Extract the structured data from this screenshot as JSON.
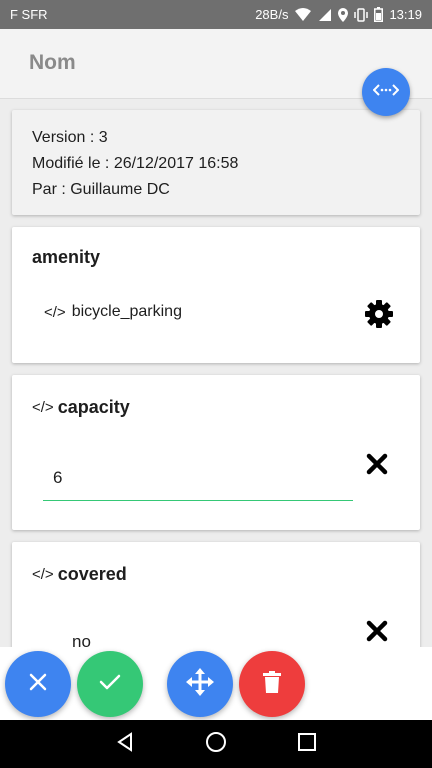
{
  "status_bar": {
    "carrier": "F SFR",
    "speed": "28B/s",
    "time": "13:19"
  },
  "header": {
    "title": "Nom"
  },
  "info": {
    "version": "Version : 3",
    "modified": "Modifié le : 26/12/2017 16:58",
    "author": "Par : Guillaume DC"
  },
  "tags": [
    {
      "key": "amenity",
      "value": "bicycle_parking"
    },
    {
      "key": "capacity",
      "value": "6"
    },
    {
      "key": "covered",
      "value": "no"
    }
  ],
  "glyphs": {
    "code": "</>"
  },
  "colors": {
    "blue": "#3e84f0",
    "green": "#35c876",
    "red": "#ee3d3d"
  },
  "icons": {
    "header_fab": "code-swap-icon",
    "settings": "gear-icon",
    "remove": "close-icon",
    "cancel": "close-icon",
    "confirm": "check-icon",
    "move": "move-icon",
    "delete": "trash-icon"
  }
}
